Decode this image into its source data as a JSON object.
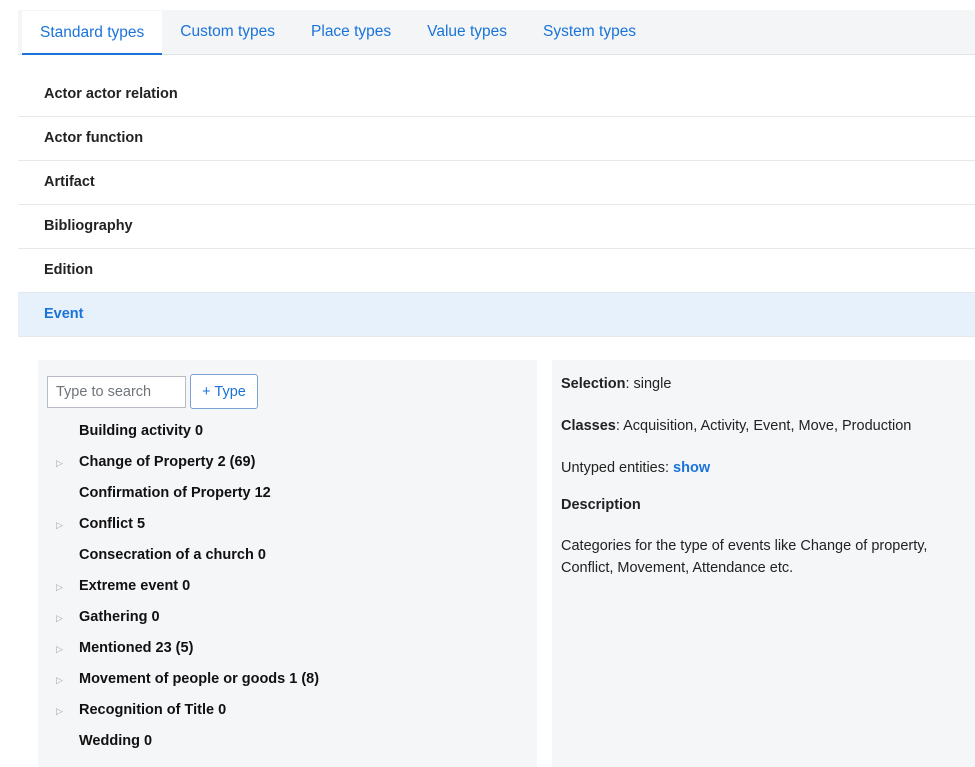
{
  "tabs": [
    "Standard types",
    "Custom types",
    "Place types",
    "Value types",
    "System types"
  ],
  "accordion": [
    "Actor actor relation",
    "Actor function",
    "Artifact",
    "Bibliography",
    "Edition",
    "Event"
  ],
  "toolbar": {
    "search_placeholder": "Type to search",
    "add_type_label": "+ Type"
  },
  "tree": [
    {
      "label": "Building activity 0",
      "arrow": ""
    },
    {
      "label": "Change of Property 2 (69)",
      "arrow": "▷"
    },
    {
      "label": "Confirmation of Property 12",
      "arrow": ""
    },
    {
      "label": "Conflict 5",
      "arrow": "▷"
    },
    {
      "label": "Consecration of a church 0",
      "arrow": ""
    },
    {
      "label": "Extreme event 0",
      "arrow": "▷"
    },
    {
      "label": "Gathering 0",
      "arrow": "▷"
    },
    {
      "label": "Mentioned 23 (5)",
      "arrow": "▷"
    },
    {
      "label": "Movement of people or goods 1 (8)",
      "arrow": "▷"
    },
    {
      "label": "Recognition of Title 0",
      "arrow": "▷"
    },
    {
      "label": "Wedding 0",
      "arrow": ""
    }
  ],
  "info": {
    "selection_label": "Selection",
    "selection_value": ": single",
    "classes_label": "Classes",
    "classes_value": ": Acquisition, Activity, Event, Move, Production",
    "untyped_label": "Untyped entities: ",
    "untyped_link": "show",
    "description_heading": "Description",
    "description_text": "Categories for the type of events like Change of property, Conflict, Movement, Attendance etc."
  }
}
